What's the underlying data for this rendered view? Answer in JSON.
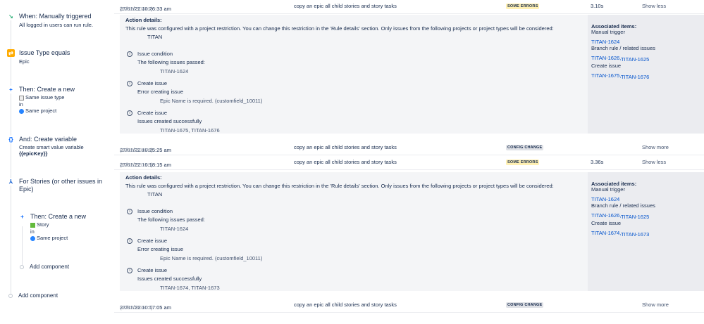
{
  "left": {
    "trigger": {
      "title": "When: Manually triggered",
      "sub": "All logged in users can run rule."
    },
    "condition": {
      "title": "Issue Type equals",
      "sub": "Epic"
    },
    "action1": {
      "title": "Then: Create a new",
      "line1": "Same issue type",
      "line2": "in",
      "line3": "Same project"
    },
    "variable": {
      "title": "And: Create variable",
      "line1": "Create smart value variable",
      "line2": "{{epicKey}}"
    },
    "branch": {
      "title": "For Stories (or other issues in",
      "title2": "Epic)"
    },
    "action2": {
      "title": "Then: Create a new",
      "line1": "Story",
      "line2": "in",
      "line3": "Same project"
    },
    "add_inner": "Add component",
    "add_outer": "Add component"
  },
  "rows": [
    {
      "ts": "27/01/22 10:26:33 am",
      "id": "(6282190412)",
      "rule": "copy an epic all child stories and story tasks",
      "badge": "SOME ERRORS",
      "dur": "3.10s",
      "toggle": "Show less"
    },
    {
      "ts": "27/01/22 10:25:25 am",
      "id": "(6282169078)",
      "rule": "copy an epic all child stories and story tasks",
      "badge": "CONFIG CHANGE",
      "dur": "",
      "toggle": "Show more"
    },
    {
      "ts": "27/01/22 10:18:15 am",
      "id": "(6282055143)",
      "rule": "copy an epic all child stories and story tasks",
      "badge": "SOME ERRORS",
      "dur": "3.36s",
      "toggle": "Show less"
    },
    {
      "ts": "27/01/22 10:17:05 am",
      "id": "(6282036501)",
      "rule": "copy an epic all child stories and story tasks",
      "badge": "CONFIG CHANGE",
      "dur": "",
      "toggle": "Show more"
    }
  ],
  "details": [
    {
      "heading": "Action details:",
      "desc": "This rule was configured with a project restriction. You can change this restriction in the 'Rule details' section. Only issues from the following projects or project types will be considered:",
      "project": "TITAN",
      "items": [
        {
          "t1": "Issue condition",
          "t2": "The following issues passed:",
          "t3": "TITAN-1624"
        },
        {
          "t1": "Create issue",
          "t2": "Error creating issue",
          "t3": "Epic Name is required. (customfield_10011)"
        },
        {
          "t1": "Create issue",
          "t2": "Issues created successfully",
          "t3": "TITAN-1675, TITAN-1676"
        }
      ],
      "assoc": {
        "h": "Associated items:",
        "trigger": "Manual trigger",
        "l1": "TITAN-1624",
        "b": "Branch rule / related issues",
        "l2a": "TITAN-1626,",
        "l2b": "TITAN-1625",
        "ci": "Create issue",
        "l3a": "TITAN-1675,",
        "l3b": "TITAN-1676"
      }
    },
    {
      "heading": "Action details:",
      "desc": "This rule was configured with a project restriction. You can change this restriction in the 'Rule details' section. Only issues from the following projects or project types will be considered:",
      "project": "TITAN",
      "items": [
        {
          "t1": "Issue condition",
          "t2": "The following issues passed:",
          "t3": "TITAN-1624"
        },
        {
          "t1": "Create issue",
          "t2": "Error creating issue",
          "t3": "Epic Name is required. (customfield_10011)"
        },
        {
          "t1": "Create issue",
          "t2": "Issues created successfully",
          "t3": "TITAN-1674, TITAN-1673"
        }
      ],
      "assoc": {
        "h": "Associated items:",
        "trigger": "Manual trigger",
        "l1": "TITAN-1624",
        "b": "Branch rule / related issues",
        "l2a": "TITAN-1626,",
        "l2b": "TITAN-1625",
        "ci": "Create issue",
        "l3a": "TITAN-1674,",
        "l3b": "TITAN-1673"
      }
    }
  ]
}
